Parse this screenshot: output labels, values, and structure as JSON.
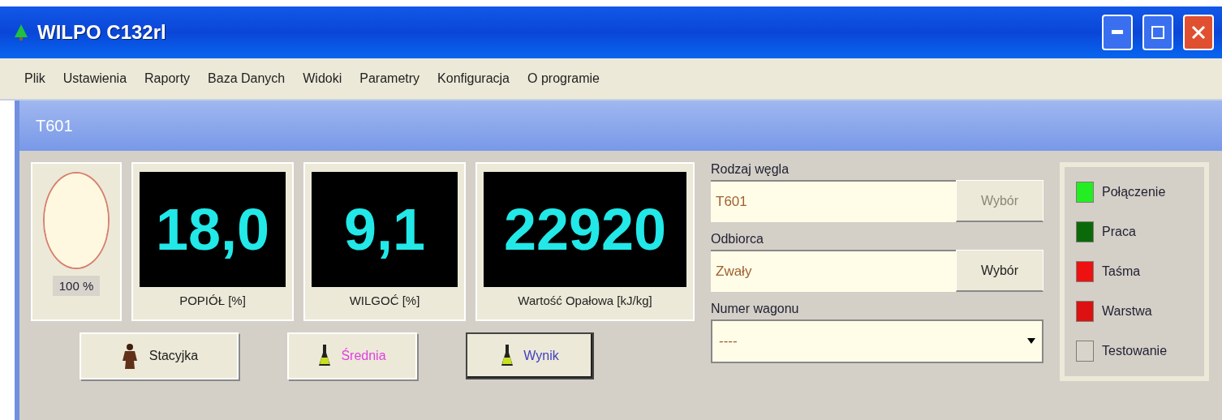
{
  "window": {
    "title": "WILPO C132rl"
  },
  "menu": [
    "Plik",
    "Ustawienia",
    "Raporty",
    "Baza Danych",
    "Widoki",
    "Parametry",
    "Konfiguracja",
    "O programie"
  ],
  "panel": {
    "title": "T601"
  },
  "gauge": {
    "level": 1,
    "reading": "100 %"
  },
  "displays": [
    {
      "value": "18,0",
      "label": "POPIÓŁ [%]"
    },
    {
      "value": "9,1",
      "label": "WILGOĆ [%]"
    },
    {
      "value": "22920",
      "label": "Wartość Opałowa [kJ/kg]"
    }
  ],
  "buttons": [
    {
      "label": "Stacyjka",
      "kind": "station",
      "color": "#202020",
      "selected": false
    },
    {
      "label": "Średnia",
      "kind": "flask",
      "color": "#e040e0",
      "selected": false
    },
    {
      "label": "Wynik",
      "kind": "flask",
      "color": "#4040c0",
      "selected": true
    }
  ],
  "fields": [
    {
      "label": "Rodzaj węgla",
      "value": "T601",
      "kind": "text",
      "button": "Wybór",
      "disabled": true
    },
    {
      "label": "Odbiorca",
      "value": "Zwały",
      "kind": "text",
      "button": "Wybór",
      "disabled": false
    },
    {
      "label": "Numer wagonu",
      "value": "----",
      "kind": "combo"
    }
  ],
  "indicators": [
    {
      "label": "Połączenie",
      "color": "#22ee22"
    },
    {
      "label": "Praca",
      "color": "#0a6a0a"
    },
    {
      "label": "Taśma",
      "color": "#ee1111"
    },
    {
      "label": "Warstwa",
      "color": "#dd1111"
    },
    {
      "label": "Testowanie",
      "color": "#d8d4cc"
    }
  ]
}
